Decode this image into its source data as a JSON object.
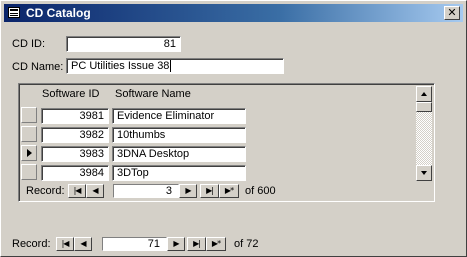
{
  "window": {
    "title": "CD Catalog",
    "close_glyph": "✕"
  },
  "form": {
    "cd_id_label": "CD ID:",
    "cd_id_value": "81",
    "cd_name_label": "CD Name:",
    "cd_name_value": "PC Utilities Issue 38"
  },
  "subform": {
    "columns": [
      "Software ID",
      "Software Name"
    ],
    "rows": [
      {
        "id": "3981",
        "name": "Evidence Eliminator"
      },
      {
        "id": "3982",
        "name": "10thumbs"
      },
      {
        "id": "3983",
        "name": "3DNA Desktop"
      },
      {
        "id": "3984",
        "name": "3DTop"
      }
    ],
    "current_row_index": 2,
    "nav": {
      "label": "Record:",
      "current": "3",
      "of_text": "of 600"
    }
  },
  "main_nav": {
    "label": "Record:",
    "current": "71",
    "of_text": "of 72"
  },
  "nav_glyphs": {
    "first": "|◀",
    "prev": "◀",
    "next": "▶",
    "last": "▶|",
    "new": "▶*"
  }
}
